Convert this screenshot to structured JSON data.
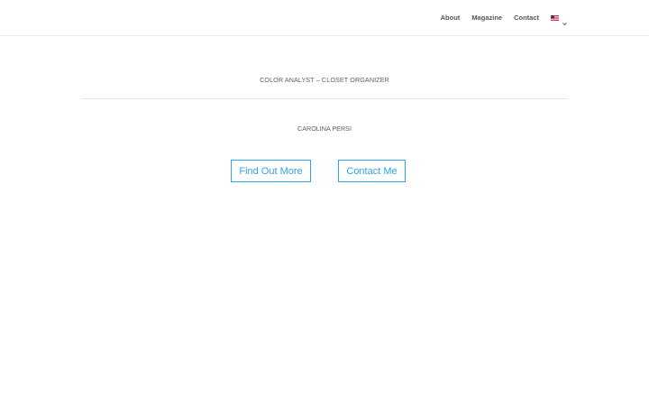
{
  "nav": {
    "items": [
      {
        "label": "About"
      },
      {
        "label": "Magazine"
      },
      {
        "label": "Contact"
      }
    ],
    "language_icon": "us-flag-icon",
    "language_chevron": "chevron-down-icon"
  },
  "hero": {
    "subtitle": "COLOR ANALYST – CLOSET ORGANIZER",
    "name": "CAROLINA PERSI",
    "buttons": {
      "find_out_more": "Find Out More",
      "contact_me": "Contact Me"
    }
  },
  "colors": {
    "accent": "#2ea3f2",
    "nav_text": "#555555",
    "body_text": "#5f5f5f"
  }
}
